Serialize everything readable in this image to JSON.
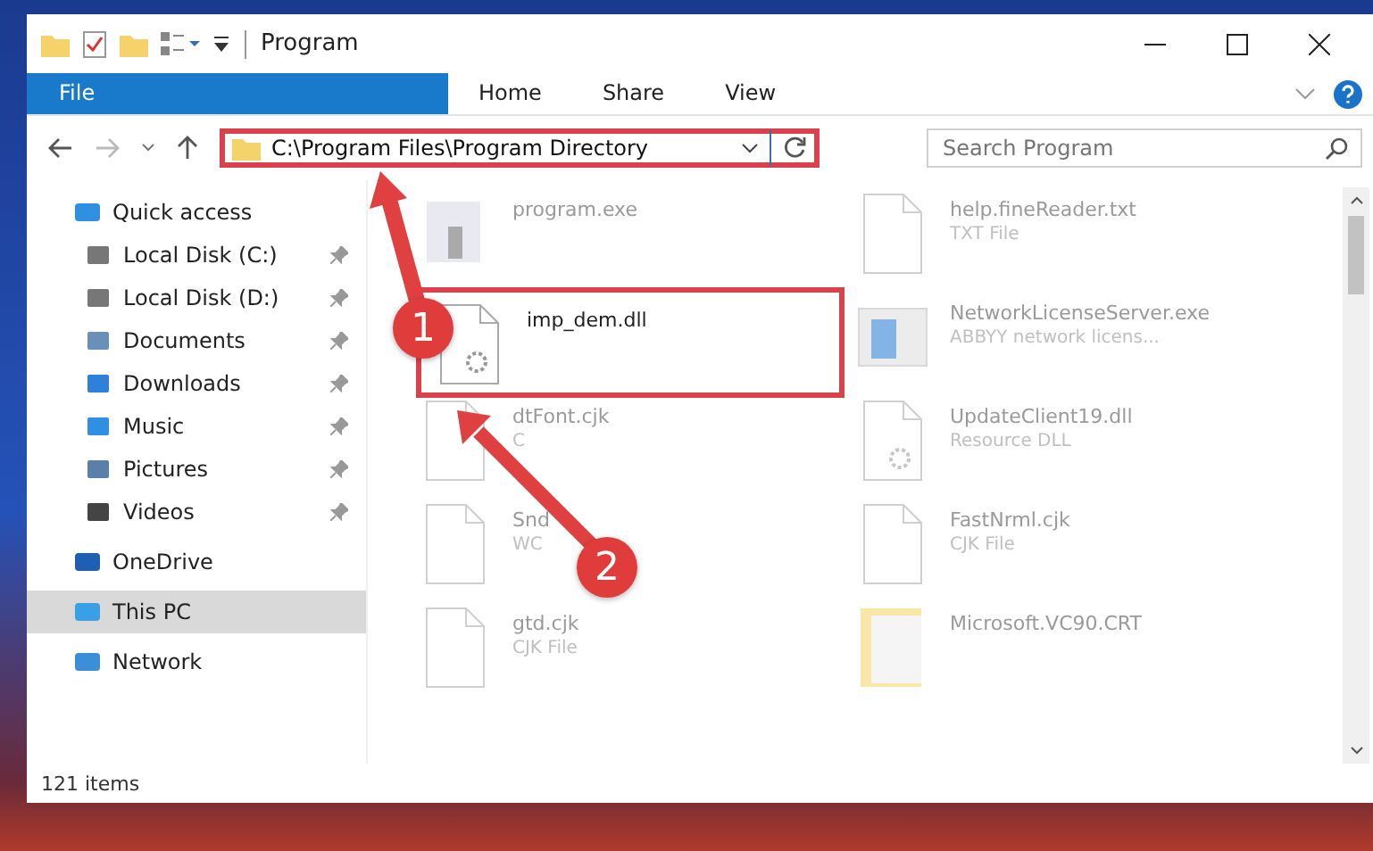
{
  "window": {
    "title": "Program"
  },
  "ribbon_tabs": [
    {
      "label": "File",
      "kind": "file",
      "selected": false
    },
    {
      "label": "Home",
      "kind": "tab",
      "selected": false
    },
    {
      "label": "Share",
      "kind": "tab",
      "selected": false
    },
    {
      "label": "View",
      "kind": "tab",
      "selected": false
    }
  ],
  "address_bar": {
    "path": "C:\\Program Files\\Program Directory",
    "highlighted": true
  },
  "search": {
    "placeholder": "Search Program"
  },
  "sidebar": {
    "items": [
      {
        "label": "Quick access",
        "kind": "star",
        "selected": false,
        "children": [
          {
            "label": "Local Disk (C:)",
            "kind": "disk",
            "pinned": true,
            "selected": false
          },
          {
            "label": "Local Disk (D:)",
            "kind": "disk",
            "pinned": true,
            "selected": false
          },
          {
            "label": "Documents",
            "kind": "document",
            "pinned": true,
            "selected": false
          },
          {
            "label": "Downloads",
            "kind": "download",
            "pinned": true,
            "selected": false
          },
          {
            "label": "Music",
            "kind": "music",
            "pinned": true,
            "selected": false
          },
          {
            "label": "Pictures",
            "kind": "picture",
            "pinned": true,
            "selected": false
          },
          {
            "label": "Videos",
            "kind": "video",
            "pinned": true,
            "selected": false
          }
        ]
      },
      {
        "label": "OneDrive",
        "kind": "cloud",
        "selected": false
      },
      {
        "label": "This PC",
        "kind": "computer",
        "selected": true
      },
      {
        "label": "Network",
        "kind": "network",
        "selected": false
      }
    ]
  },
  "files": [
    {
      "name": "program.exe",
      "kind": "exe",
      "faded": true,
      "highlighted": false
    },
    {
      "name": "help.fineReader.txt",
      "type": "TXT File",
      "kind": "txt",
      "faded": true,
      "highlighted": false
    },
    {
      "name": "imp_dem.dll",
      "kind": "dll",
      "faded": false,
      "highlighted": true
    },
    {
      "name": "NetworkLicenseServer.exe",
      "type": "ABBYY network licens...",
      "kind": "app",
      "faded": true,
      "highlighted": false
    },
    {
      "name": "dtFont.cjk",
      "type": "C",
      "kind": "cjk",
      "faded": true,
      "highlighted": false
    },
    {
      "name": "UpdateClient19.dll",
      "type": "Resource DLL",
      "kind": "dll",
      "faded": true,
      "highlighted": false
    },
    {
      "name": "Snd",
      "type": "WC",
      "kind": "cjk",
      "faded": true,
      "highlighted": false
    },
    {
      "name": "FastNrml.cjk",
      "type": "CJK File",
      "kind": "cjk",
      "faded": true,
      "highlighted": false
    },
    {
      "name": "gtd.cjk",
      "type": "CJK File",
      "kind": "cjk",
      "faded": true,
      "highlighted": false
    },
    {
      "name": "Microsoft.VC90.CRT",
      "kind": "folder",
      "faded": true,
      "highlighted": false
    }
  ],
  "steps": [
    "1",
    "2"
  ],
  "status_bar": {
    "item_count": "121 items"
  }
}
